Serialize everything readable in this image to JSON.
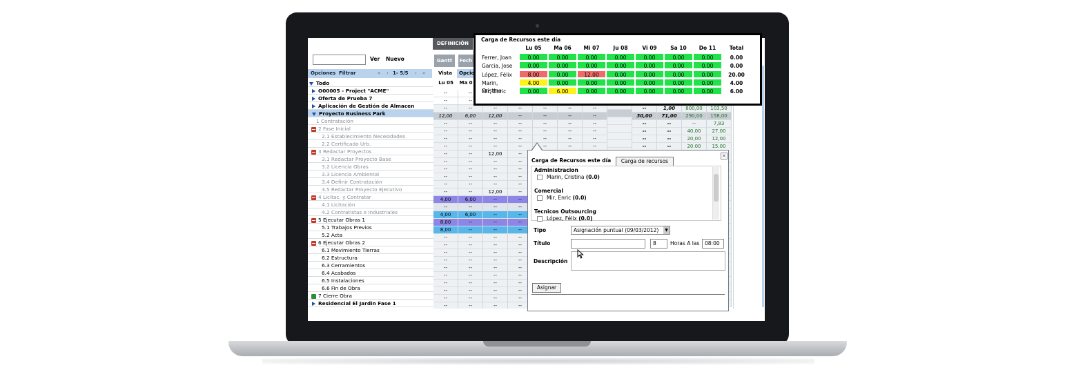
{
  "toolbar": {
    "definicion_tab": "DEFINICIÓN",
    "ver_label": "Ver",
    "nuevo_label": "Nuevo",
    "gantt_button": "Gantt",
    "fecha_button": "Fech",
    "opciones_label": "Opciones",
    "filtrar_label": "Filtrar",
    "pager": "1- 5/5",
    "vista_label": "Vista",
    "opcio_label": "Opcio"
  },
  "tree": {
    "root_label": "Todo",
    "rows": [
      {
        "label": "O00005 - Project \"ACME\"",
        "style": "project"
      },
      {
        "label": "Oferta de Prueba 7",
        "style": "project"
      },
      {
        "label": "Aplicación de Gestión de Almacen",
        "style": "project"
      },
      {
        "label": "Proyecto Business Park",
        "style": "selected"
      },
      {
        "label": "1 Contratación",
        "style": "grey1"
      },
      {
        "label": "2 Fase Inicial",
        "style": "grey1-minus"
      },
      {
        "label": "2.1 Establecimiento Necesidades",
        "style": "grey2"
      },
      {
        "label": "2.2 Certificado Urb.",
        "style": "grey2"
      },
      {
        "label": "3 Redactar Proyectos",
        "style": "grey1-minus"
      },
      {
        "label": "3.1 Redactar Proyecto Base",
        "style": "grey2"
      },
      {
        "label": "3.2 Licencia Obras",
        "style": "grey2"
      },
      {
        "label": "3.3 Licencia Ambiental",
        "style": "grey2"
      },
      {
        "label": "3.4 Definir Contratación",
        "style": "grey2"
      },
      {
        "label": "3.5 Redactar Proyecto Ejecutivo",
        "style": "grey2"
      },
      {
        "label": "4 Licitac. y Contratar",
        "style": "grey1-minus"
      },
      {
        "label": "4.1 Licitación",
        "style": "grey2"
      },
      {
        "label": "4.2 Contratistas e Industriales",
        "style": "grey2"
      },
      {
        "label": "5 Ejecutar Obras 1",
        "style": "black1-minus"
      },
      {
        "label": "5.1 Trabajos Previos",
        "style": "black2"
      },
      {
        "label": "5.2 Acta",
        "style": "black2"
      },
      {
        "label": "6 Ejecutar Obras 2",
        "style": "black1-minus"
      },
      {
        "label": "6.1 Movimiento Tierras",
        "style": "black2"
      },
      {
        "label": "6.2 Estructura",
        "style": "black2"
      },
      {
        "label": "6.3 Cerramientos",
        "style": "black2"
      },
      {
        "label": "6.4 Acabados",
        "style": "black2"
      },
      {
        "label": "6.5 Instalaciones",
        "style": "black2"
      },
      {
        "label": "6.6 Fin de Obra",
        "style": "black2"
      },
      {
        "label": "7 Cierre Obra",
        "style": "black1-plus"
      },
      {
        "label": "Residencial El Jardin Fase 1",
        "style": "project"
      }
    ]
  },
  "grid": {
    "headers": [
      "Lu 05",
      "Ma 0"
    ],
    "rows": [
      [
        "--",
        "--",
        "--",
        "--",
        "--",
        "--",
        "--",
        "",
        "",
        "",
        "",
        "",
        ""
      ],
      [
        "--",
        "--",
        "--",
        "--",
        "--",
        "--",
        "--",
        "",
        "",
        "",
        "",
        "",
        ""
      ],
      [
        "--",
        "--",
        "--",
        "--",
        "--",
        "--",
        "--",
        "",
        "--",
        "1,00",
        "800,00",
        "103,50"
      ],
      [
        "12,00",
        "6,00",
        "12,00",
        "--",
        "--",
        "--",
        "--",
        "",
        "30,00",
        "71,00",
        "290,00",
        "158,00"
      ],
      [
        "--",
        "--",
        "--",
        "--",
        "--",
        "--",
        "--",
        "",
        "--",
        "--",
        "--",
        "7,83"
      ],
      [
        "--",
        "--",
        "--",
        "--",
        "--",
        "--",
        "--",
        "",
        "--",
        "--",
        "40,00",
        "27,00"
      ],
      [
        "--",
        "--",
        "--",
        "--",
        "--",
        "--",
        "--",
        "",
        "--",
        "--",
        "20,00",
        "12,00"
      ],
      [
        "--",
        "--",
        "--",
        "--",
        "--",
        "--",
        "--",
        "",
        "--",
        "--",
        "20,00",
        "15,00"
      ],
      [
        "--",
        "--",
        "12,00",
        "--",
        "",
        "",
        "",
        "",
        "",
        "",
        "",
        ""
      ],
      [
        "--",
        "--",
        "--",
        "--",
        "",
        "",
        "",
        "",
        "",
        "",
        "",
        ""
      ],
      [
        "--",
        "--",
        "--",
        "--",
        "",
        "",
        "",
        "",
        "",
        "",
        "",
        ""
      ],
      [
        "--",
        "--",
        "--",
        "--",
        "",
        "",
        "",
        "",
        "",
        "",
        "",
        ""
      ],
      [
        "--",
        "--",
        "--",
        "--",
        "",
        "",
        "",
        "",
        "",
        "",
        "",
        ""
      ],
      [
        "--",
        "--",
        "12,00",
        "--",
        "",
        "",
        "",
        "",
        "",
        "",
        "",
        ""
      ],
      [
        "4,00",
        "6,00",
        "--",
        "--",
        "",
        "",
        "",
        "",
        "",
        "",
        "",
        ""
      ],
      [
        "--",
        "--",
        "--",
        "--",
        "",
        "",
        "",
        "",
        "",
        "",
        "",
        ""
      ],
      [
        "4,00",
        "6,00",
        "--",
        "--",
        "",
        "",
        "",
        "",
        "",
        "",
        "",
        ""
      ],
      [
        "8,00",
        "--",
        "--",
        "--",
        "",
        "",
        "",
        "",
        "",
        "",
        "",
        ""
      ],
      [
        "8,00",
        "--",
        "--",
        "--",
        "",
        "",
        "",
        "",
        "",
        "",
        "",
        ""
      ],
      [
        "--",
        "--",
        "--",
        "--",
        "",
        "",
        "",
        "",
        "",
        "",
        "",
        ""
      ],
      [
        "--",
        "--",
        "--",
        "--",
        "",
        "",
        "",
        "",
        "",
        "",
        "",
        ""
      ],
      [
        "--",
        "--",
        "--",
        "--",
        "",
        "",
        "",
        "",
        "",
        "",
        "",
        ""
      ],
      [
        "--",
        "--",
        "--",
        "--",
        "",
        "",
        "",
        "",
        "",
        "",
        "",
        ""
      ],
      [
        "--",
        "--",
        "--",
        "--",
        "",
        "",
        "",
        "",
        "",
        "",
        "",
        ""
      ],
      [
        "--",
        "--",
        "--",
        "--",
        "",
        "",
        "",
        "",
        "",
        "",
        "",
        ""
      ],
      [
        "--",
        "--",
        "--",
        "--",
        "",
        "",
        "",
        "",
        "",
        "",
        "",
        ""
      ],
      [
        "--",
        "--",
        "--",
        "--",
        "",
        "",
        "",
        "",
        "",
        "",
        "",
        ""
      ],
      [
        "--",
        "--",
        "--",
        "--",
        "",
        "",
        "",
        "",
        "",
        "",
        "",
        ""
      ],
      [
        "--",
        "--",
        "--",
        "--",
        "",
        "",
        "",
        "",
        "",
        "",
        "",
        ""
      ]
    ]
  },
  "carga_popup": {
    "title": "Carga de Recursos este día",
    "headers": [
      "Lu 05",
      "Ma 06",
      "Mi 07",
      "Ju 08",
      "Vi 09",
      "Sa 10",
      "Do 11",
      "Total"
    ],
    "rows": [
      {
        "name": "Ferrer, Joan",
        "values": [
          "0.00",
          "0.00",
          "0.00",
          "0.00",
          "0.00",
          "0.00",
          "0.00"
        ],
        "colors": [
          "g",
          "g",
          "g",
          "g",
          "g",
          "g",
          "g"
        ],
        "total": "0.00"
      },
      {
        "name": "Garcia, Jose",
        "values": [
          "0.00",
          "0.00",
          "0.00",
          "0.00",
          "0.00",
          "0.00",
          "0.00"
        ],
        "colors": [
          "g",
          "g",
          "g",
          "g",
          "g",
          "g",
          "g"
        ],
        "total": "0.00"
      },
      {
        "name": "López, Félix",
        "values": [
          "8.00",
          "0.00",
          "12.00",
          "0.00",
          "0.00",
          "0.00",
          "0.00"
        ],
        "colors": [
          "r",
          "g",
          "r",
          "g",
          "g",
          "g",
          "g"
        ],
        "total": "20.00"
      },
      {
        "name": "Marin, Cristina",
        "values": [
          "4.00",
          "0.00",
          "0.00",
          "0.00",
          "0.00",
          "0.00",
          "0.00"
        ],
        "colors": [
          "y",
          "g",
          "g",
          "g",
          "g",
          "g",
          "g"
        ],
        "total": "4.00"
      },
      {
        "name": "Mir, Enric",
        "values": [
          "0.00",
          "6.00",
          "0.00",
          "0.00",
          "0.00",
          "0.00",
          "0.00"
        ],
        "colors": [
          "g",
          "y",
          "g",
          "g",
          "g",
          "g",
          "g"
        ],
        "total": "6.00"
      }
    ],
    "colors": {
      "g": "#22e24a",
      "r": "#f06a6a",
      "y": "#fff21a"
    }
  },
  "assign_popup": {
    "title": "Carga de Recursos este día",
    "button": "Carga de recursos",
    "groups": [
      {
        "name": "Administracion",
        "member": "Marin, Cristina",
        "load": "(0.0)"
      },
      {
        "name": "Comercial",
        "member": "Mir, Enric",
        "load": "(0.0)"
      },
      {
        "name": "Tecnicos Outsourcing",
        "member": "López, Félix",
        "load": "(0.0)"
      }
    ],
    "tipo_label": "Tipo",
    "tipo_value": "Asignación puntual (09/03/2012)",
    "titulo_label": "Título",
    "hours_value": "8",
    "horas_label": "Horas A las",
    "time_value": "08:00",
    "descripcion_label": "Descripción",
    "asignar_button": "Asignar",
    "close_symbol": "×"
  }
}
